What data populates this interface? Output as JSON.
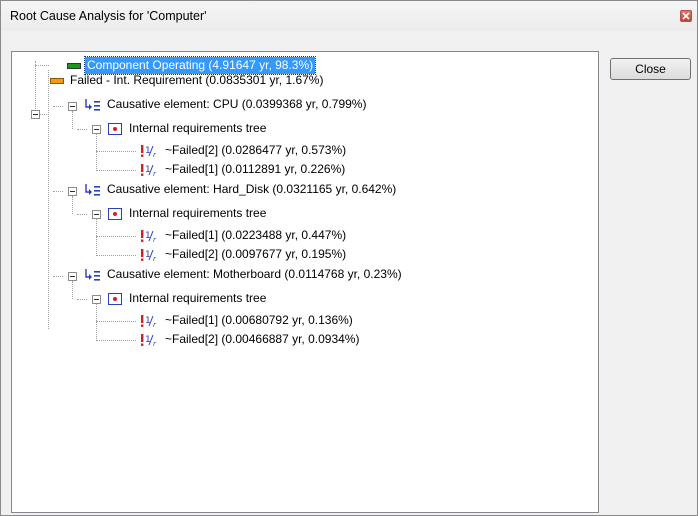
{
  "window": {
    "title": "Root Cause Analysis for 'Computer'",
    "close_button_label": "Close"
  },
  "tree": {
    "root": {
      "label": "Component Operating (4.91647 yr, 98.3%)"
    },
    "failed": {
      "label": "Failed - Int. Requirement (0.0835301 yr, 1.67%)"
    },
    "cpu": {
      "label": "Causative element: CPU (0.0399368 yr, 0.799%)",
      "req_label": "Internal requirements tree",
      "items": [
        {
          "label": "~Failed[2] (0.0286477 yr, 0.573%)"
        },
        {
          "label": "~Failed[1] (0.0112891 yr, 0.226%)"
        }
      ]
    },
    "hdd": {
      "label": "Causative element: Hard_Disk (0.0321165 yr, 0.642%)",
      "req_label": "Internal requirements tree",
      "items": [
        {
          "label": "~Failed[1] (0.0223488 yr, 0.447%)"
        },
        {
          "label": "~Failed[2] (0.0097677 yr, 0.195%)"
        }
      ]
    },
    "mb": {
      "label": "Causative element: Motherboard (0.0114768 yr, 0.23%)",
      "req_label": "Internal requirements tree",
      "items": [
        {
          "label": "~Failed[1] (0.00680792 yr, 0.136%)"
        },
        {
          "label": "~Failed[2] (0.00466887 yr, 0.0934%)"
        }
      ]
    }
  },
  "colors": {
    "selection": "#3399ff",
    "operating_icon": "#1a9a1a",
    "failed_icon": "#f39a1a",
    "fail_mark": "#d42020"
  }
}
